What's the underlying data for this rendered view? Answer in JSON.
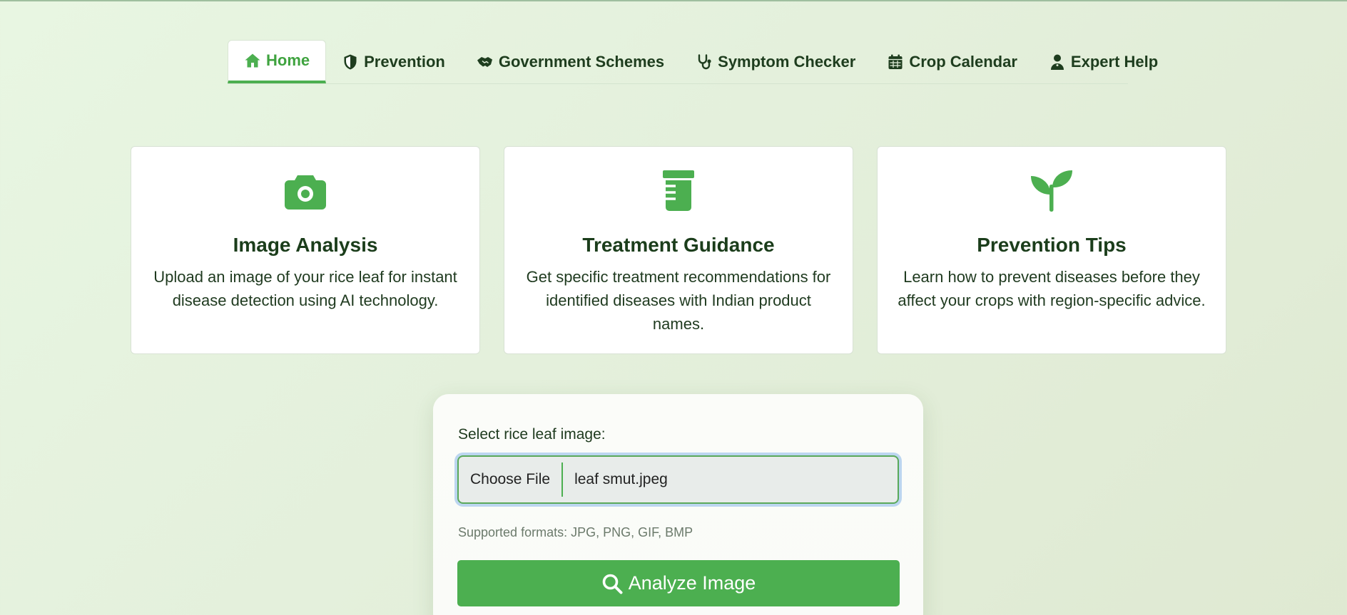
{
  "nav": {
    "tabs": [
      {
        "label": "Home",
        "icon": "home-icon",
        "active": true
      },
      {
        "label": "Prevention",
        "icon": "shield-icon",
        "active": false
      },
      {
        "label": "Government Schemes",
        "icon": "handshake-icon",
        "active": false
      },
      {
        "label": "Symptom Checker",
        "icon": "stethoscope-icon",
        "active": false
      },
      {
        "label": "Crop Calendar",
        "icon": "calendar-icon",
        "active": false
      },
      {
        "label": "Expert Help",
        "icon": "user-doctor-icon",
        "active": false
      }
    ]
  },
  "features": [
    {
      "icon": "camera-icon",
      "title": "Image Analysis",
      "text": "Upload an image of your rice leaf for instant disease detection using AI technology."
    },
    {
      "icon": "prescription-bottle-icon",
      "title": "Treatment Guidance",
      "text": "Get specific treatment recommendations for identified diseases with Indian product names."
    },
    {
      "icon": "seedling-icon",
      "title": "Prevention Tips",
      "text": "Learn how to prevent diseases before they affect your crops with region-specific advice."
    }
  ],
  "upload": {
    "label": "Select rice leaf image:",
    "choose_button": "Choose File",
    "file_name": "leaf smut.jpeg",
    "hint": "Supported formats: JPG, PNG, GIF, BMP",
    "analyze_button": "Analyze Image"
  },
  "colors": {
    "accent": "#4caf50",
    "text_dark": "#1b3d1b",
    "background": "#e6f3df"
  }
}
